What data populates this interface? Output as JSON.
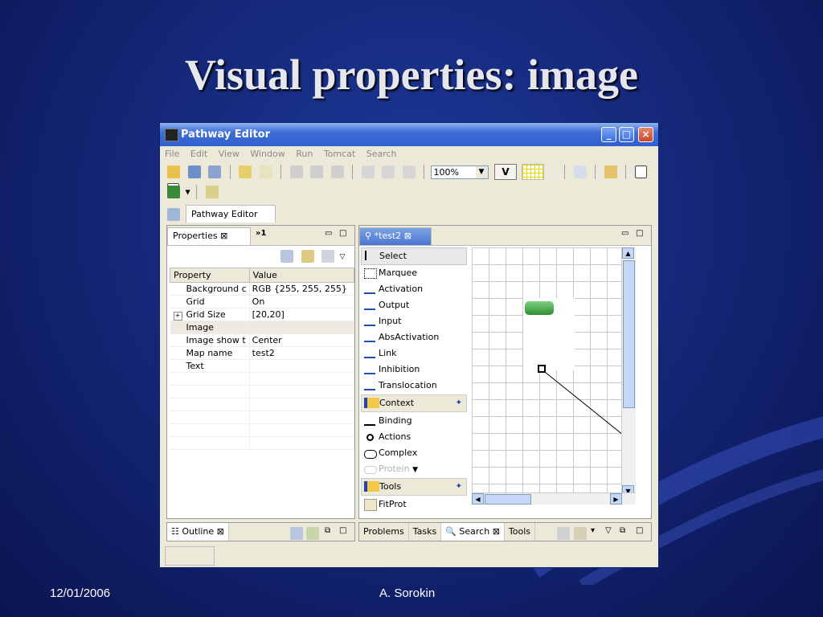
{
  "slide": {
    "title": "Visual properties: image",
    "date": "12/01/2006",
    "author": "A. Sorokin"
  },
  "window": {
    "title": "Pathway Editor",
    "menu": [
      "File",
      "Edit",
      "View",
      "Window",
      "Run",
      "Tomcat",
      "Search"
    ],
    "zoom": "100%",
    "v_button": "V",
    "editor_tab": "Pathway Editor"
  },
  "properties_view": {
    "tab_label": "Properties",
    "overflow_tab": "»1",
    "columns": [
      "Property",
      "Value"
    ],
    "rows": [
      {
        "name": "Background c",
        "value": "RGB {255, 255, 255}"
      },
      {
        "name": "Grid",
        "value": "On"
      },
      {
        "name": "Grid Size",
        "value": "[20,20]"
      },
      {
        "name": "Image",
        "value": ""
      },
      {
        "name": "Image show t",
        "value": "Center"
      },
      {
        "name": "Map name",
        "value": "test2"
      },
      {
        "name": "Text",
        "value": ""
      }
    ]
  },
  "diagram_editor": {
    "tab_label": "*test2",
    "palette": {
      "tools": [
        "Select",
        "Marquee",
        "Activation",
        "Output",
        "Input",
        "AbsActivation",
        "Link",
        "Inhibition",
        "Translocation"
      ],
      "drawer_context": "Context",
      "context_items": [
        "Binding",
        "Actions",
        "Complex",
        "Protein"
      ],
      "drawer_tools": "Tools",
      "tools_items": [
        "FitProt"
      ]
    }
  },
  "outline_view": {
    "tab_label": "Outline"
  },
  "bottom_tabs": [
    "Problems",
    "Tasks",
    "Search",
    "Tools"
  ],
  "colors": {
    "slide_bg": "#15287a",
    "title_bar": "#2f5fcc",
    "node_green": "#3a9a3a"
  }
}
